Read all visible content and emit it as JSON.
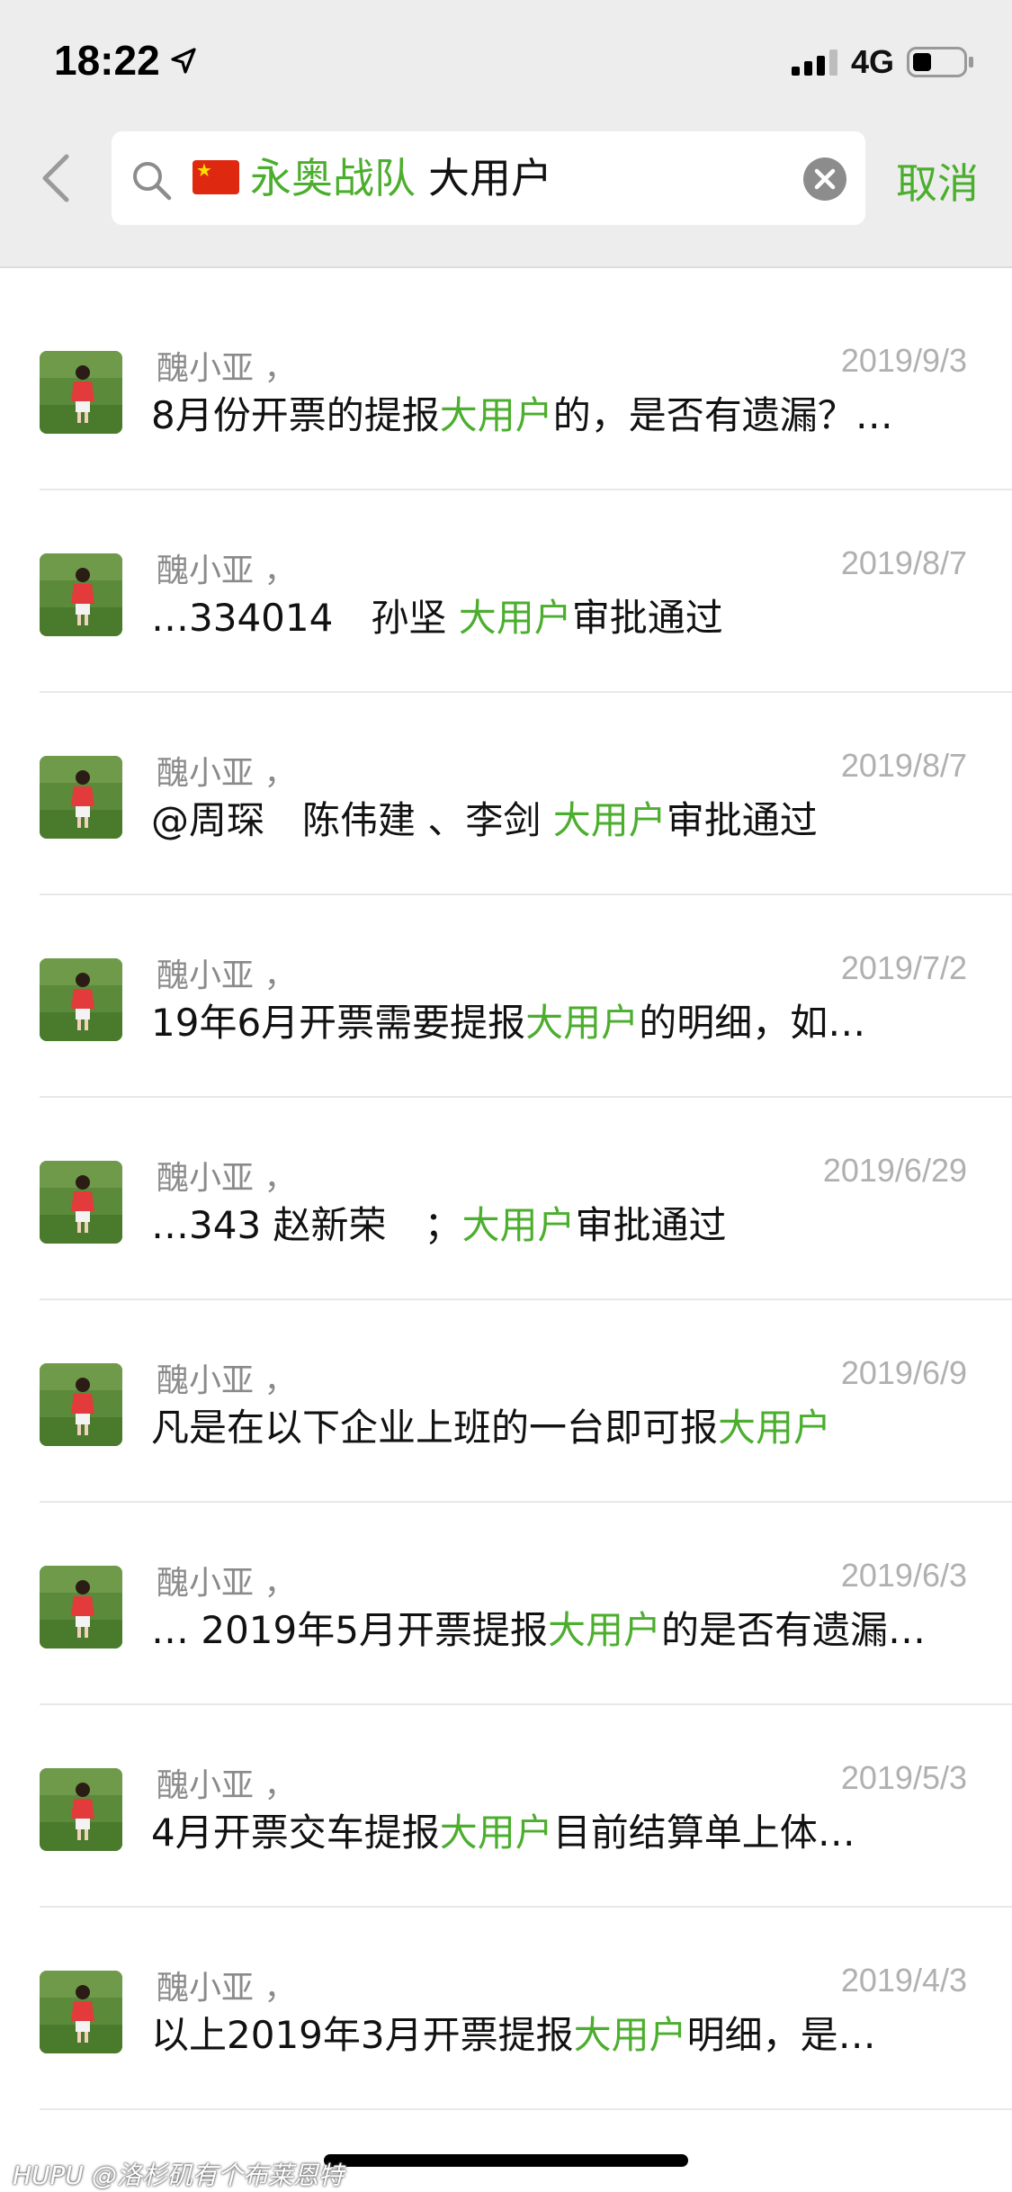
{
  "status_bar": {
    "time": "18:22",
    "network": "4G"
  },
  "search": {
    "tag": "永奥战队",
    "query": "大用户",
    "cancel_label": "取消"
  },
  "results": [
    {
      "sender": "醜小亚 ，",
      "date": "2019/9/3",
      "pre": " 8月份开票的提报",
      "hl": "大用户",
      "post": "的，是否有遗漏？…"
    },
    {
      "sender": "醜小亚 ，",
      "date": "2019/8/7",
      "pre": "…334014　孙坚 ",
      "hl": "大用户",
      "post": "审批通过"
    },
    {
      "sender": "醜小亚 ，",
      "date": "2019/8/7",
      "pre": "@周琛　陈伟建 、李剑 ",
      "hl": "大用户",
      "post": "审批通过"
    },
    {
      "sender": "醜小亚 ，",
      "date": "2019/7/2",
      "pre": " 19年6月开票需要提报",
      "hl": "大用户",
      "post": "的明细，如…"
    },
    {
      "sender": "醜小亚 ，",
      "date": "2019/6/29",
      "pre": "…343  赵新荣　；",
      "hl": "大用户",
      "post": "审批通过"
    },
    {
      "sender": "醜小亚 ，",
      "date": "2019/6/9",
      "pre": " 凡是在以下企业上班的一台即可报",
      "hl": "大用户",
      "post": ""
    },
    {
      "sender": "醜小亚 ，",
      "date": "2019/6/3",
      "pre": "… 2019年5月开票提报",
      "hl": "大用户",
      "post": "的是否有遗漏…"
    },
    {
      "sender": "醜小亚 ，",
      "date": "2019/5/3",
      "pre": "  4月开票交车提报",
      "hl": "大用户",
      "post": "目前结算单上体…"
    },
    {
      "sender": "醜小亚 ，",
      "date": "2019/4/3",
      "pre": " 以上2019年3月开票提报",
      "hl": "大用户",
      "post": "明细，是…"
    }
  ],
  "watermark": "HUPU @洛杉矶有个布莱恩特",
  "colors": {
    "accent": "#4cae2e",
    "topbar": "#ededed"
  },
  "icons": [
    "location-arrow-icon",
    "signal-icon",
    "battery-icon",
    "back-icon",
    "search-icon",
    "china-flag-icon",
    "clear-icon"
  ]
}
